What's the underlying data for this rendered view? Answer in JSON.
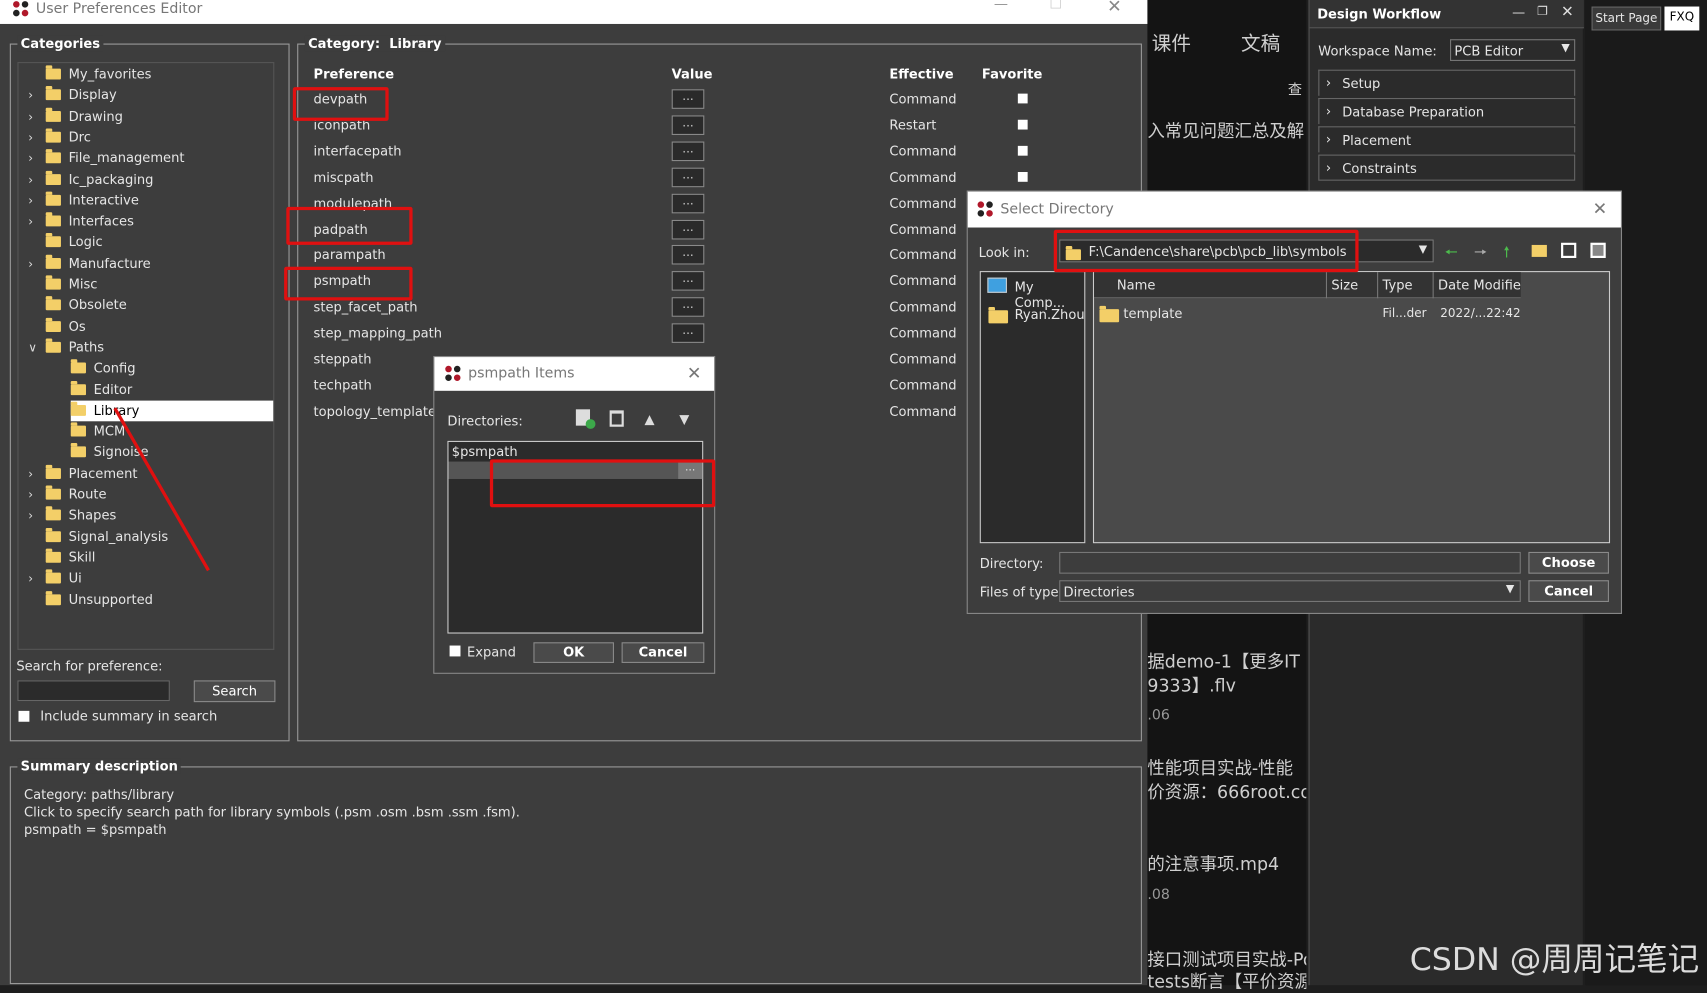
{
  "main_window": {
    "title": "User Preferences Editor"
  },
  "categories": {
    "title": "Categories",
    "items": [
      {
        "label": "My_favorites",
        "expandable": false,
        "level": 0
      },
      {
        "label": "Display",
        "expandable": true,
        "level": 0
      },
      {
        "label": "Drawing",
        "expandable": true,
        "level": 0
      },
      {
        "label": "Drc",
        "expandable": true,
        "level": 0
      },
      {
        "label": "File_management",
        "expandable": true,
        "level": 0
      },
      {
        "label": "Ic_packaging",
        "expandable": true,
        "level": 0
      },
      {
        "label": "Interactive",
        "expandable": true,
        "level": 0
      },
      {
        "label": "Interfaces",
        "expandable": true,
        "level": 0
      },
      {
        "label": "Logic",
        "expandable": false,
        "level": 0
      },
      {
        "label": "Manufacture",
        "expandable": true,
        "level": 0
      },
      {
        "label": "Misc",
        "expandable": false,
        "level": 0
      },
      {
        "label": "Obsolete",
        "expandable": false,
        "level": 0
      },
      {
        "label": "Os",
        "expandable": false,
        "level": 0
      },
      {
        "label": "Paths",
        "expandable": true,
        "expanded": true,
        "level": 0
      },
      {
        "label": "Config",
        "expandable": false,
        "level": 1
      },
      {
        "label": "Editor",
        "expandable": false,
        "level": 1
      },
      {
        "label": "Library",
        "expandable": false,
        "level": 1,
        "selected": true
      },
      {
        "label": "MCM",
        "expandable": false,
        "level": 1
      },
      {
        "label": "Signoise",
        "expandable": false,
        "level": 1
      },
      {
        "label": "Placement",
        "expandable": true,
        "level": 0
      },
      {
        "label": "Route",
        "expandable": true,
        "level": 0
      },
      {
        "label": "Shapes",
        "expandable": true,
        "level": 0
      },
      {
        "label": "Signal_analysis",
        "expandable": false,
        "level": 0
      },
      {
        "label": "Skill",
        "expandable": false,
        "level": 0
      },
      {
        "label": "Ui",
        "expandable": true,
        "level": 0
      },
      {
        "label": "Unsupported",
        "expandable": false,
        "level": 0
      }
    ],
    "search_label": "Search for preference:",
    "search_value": "",
    "search_button": "Search",
    "include_summary": "Include summary in search"
  },
  "category_panel": {
    "title_prefix": "Category:",
    "title_value": "Library",
    "columns": {
      "preference": "Preference",
      "value": "Value",
      "effective": "Effective",
      "favorite": "Favorite"
    },
    "rows": [
      {
        "name": "devpath",
        "value": "...",
        "effective": "Command",
        "fav": true
      },
      {
        "name": "iconpath",
        "value": "...",
        "effective": "Restart",
        "fav": true
      },
      {
        "name": "interfacepath",
        "value": "...",
        "effective": "Command",
        "fav": true
      },
      {
        "name": "miscpath",
        "value": "...",
        "effective": "Command",
        "fav": true
      },
      {
        "name": "modulepath",
        "value": "...",
        "effective": "Command",
        "fav": false
      },
      {
        "name": "padpath",
        "value": "...",
        "effective": "Command",
        "fav": false
      },
      {
        "name": "parampath",
        "value": "...",
        "effective": "Command",
        "fav": false
      },
      {
        "name": "psmpath",
        "value": "...",
        "effective": "Command",
        "fav": false
      },
      {
        "name": "step_facet_path",
        "value": "...",
        "effective": "Command",
        "fav": false
      },
      {
        "name": "step_mapping_path",
        "value": "...",
        "effective": "Command",
        "fav": false
      },
      {
        "name": "steppath",
        "value": "",
        "effective": "Command",
        "fav": false
      },
      {
        "name": "techpath",
        "value": "",
        "effective": "Command",
        "fav": false
      },
      {
        "name": "topology_template_p",
        "value": "",
        "effective": "Command",
        "fav": false
      }
    ]
  },
  "summary": {
    "title": "Summary description",
    "line1": "Category: paths/library",
    "line2": "Click to specify search path for library symbols (.psm .osm .bsm .ssm .fsm).",
    "line3": "psmpath = $psmpath"
  },
  "psm_dialog": {
    "title": "psmpath Items",
    "directories_label": "Directories:",
    "list_item": "$psmpath",
    "browse": "...",
    "expand_label": "Expand",
    "ok": "OK",
    "cancel": "Cancel"
  },
  "select_dir": {
    "title": "Select Directory",
    "look_in_label": "Look in:",
    "look_in_value": "F:\\Candence\\share\\pcb\\pcb_lib\\symbols",
    "places": [
      "My Comp...",
      "Ryan.Zhou"
    ],
    "columns": {
      "name": "Name",
      "size": "Size",
      "type": "Type",
      "date": "Date Modifiec"
    },
    "files": [
      {
        "name": "template",
        "size": "",
        "type": "Fil...der",
        "date": "2022/...22:42"
      }
    ],
    "directory_label": "Directory:",
    "directory_value": "",
    "files_type_label": "Files of type:",
    "files_type_value": "Directories",
    "choose": "Choose",
    "cancel": "Cancel"
  },
  "design_workflow": {
    "title": "Design Workflow",
    "workspace_label": "Workspace Name:",
    "workspace_value": "PCB Editor",
    "items": [
      "Setup",
      "Database Preparation",
      "Placement",
      "Constraints"
    ]
  },
  "tabs": {
    "start_page": "Start Page",
    "fxq": "FXQ"
  },
  "background_text": {
    "t1": "课件",
    "t2": "文稿",
    "t3": "查",
    "t4": "入常见问题汇总及解",
    "t5": "据demo-1【更多IT",
    "t6": "9333】.flv",
    "t7": ".06",
    "t8": "性能项目实战-性能",
    "t9": "价资源：666root.co",
    "t10": "的注意事项.mp4",
    "t11": ".08",
    "t12": "接口测试项目实战-Po",
    "t13": "tests断言【平价资源"
  },
  "watermark": "CSDN @周周记笔记"
}
